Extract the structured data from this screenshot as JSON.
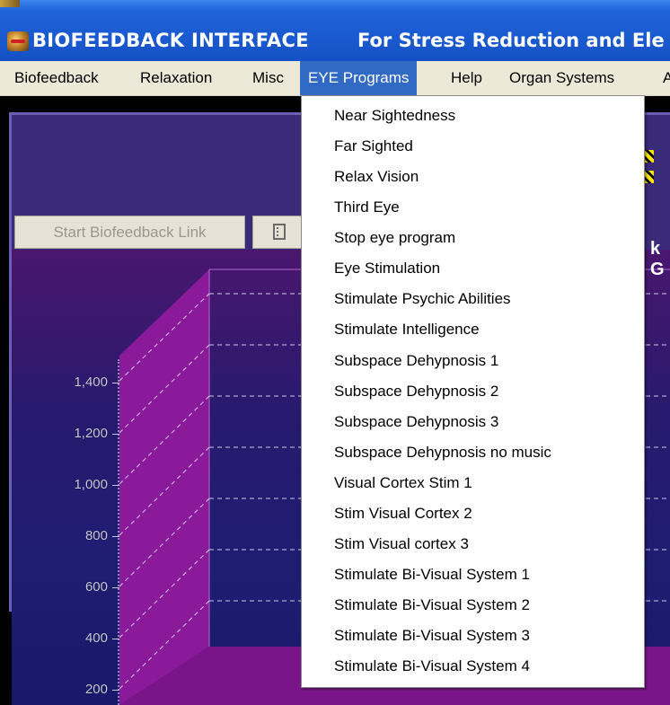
{
  "window": {
    "title": "BIOFEEDBACK INTERFACE",
    "subtitle": "For Stress Reduction and Ele"
  },
  "menubar": {
    "items": [
      "Biofeedback",
      "Relaxation",
      "Misc",
      "EYE Programs",
      "Help",
      "Organ Systems",
      "A"
    ],
    "active": "EYE Programs"
  },
  "dropdown": {
    "items": [
      "Near Sightedness",
      "Far Sighted",
      "Relax Vision",
      "Third Eye",
      "Stop eye program",
      "Eye Stimulation",
      "Stimulate Psychic Abilities",
      "Stimulate Intelligence",
      "Subspace Dehypnosis 1",
      "Subspace Dehypnosis 2",
      "Subspace Dehypnosis 3",
      "Subspace Dehypnosis no music",
      "Visual Cortex Stim 1",
      "Stim Visual Cortex 2",
      "Stim Visual cortex 3",
      "Stimulate Bi-Visual System 1",
      "Stimulate Bi-Visual System 2",
      "Stimulate Bi-Visual System 3",
      "Stimulate Bi-Visual System 4"
    ]
  },
  "toolbar": {
    "start_label": "Start Biofeedback Link"
  },
  "chart": {
    "right_label": "k G",
    "y_ticks": [
      "1,400",
      "1,200",
      "1,000",
      "800",
      "600",
      "400",
      "200"
    ]
  },
  "colors": {
    "menu_highlight": "#316ac5",
    "chart_side": "#8b1a9a",
    "chart_floor": "#7a1589"
  }
}
